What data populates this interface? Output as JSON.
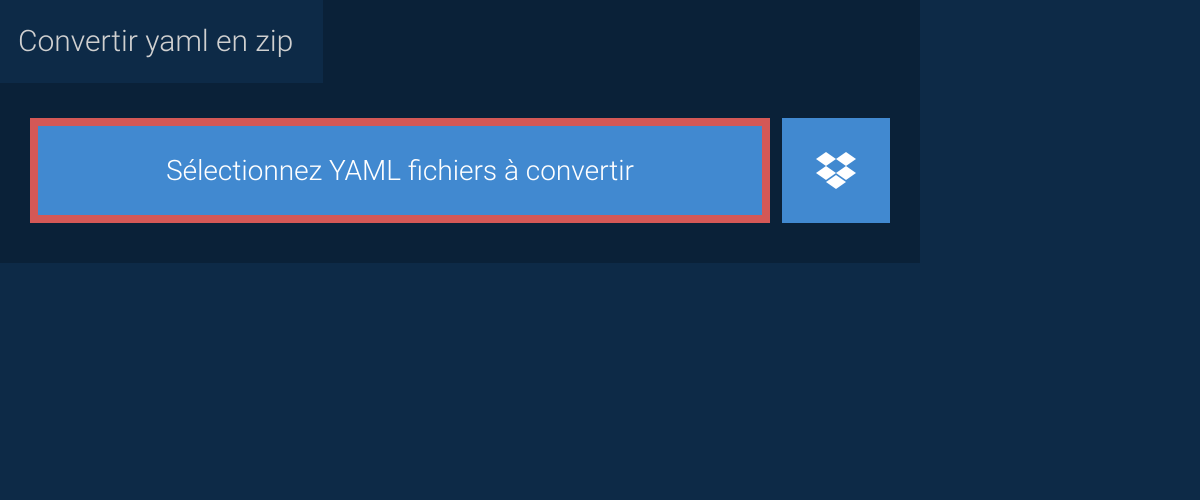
{
  "tab": {
    "title": "Convertir yaml en zip"
  },
  "buttons": {
    "select_files_label": "Sélectionnez YAML fichiers à convertir"
  },
  "colors": {
    "background": "#0d2a47",
    "panel": "#0a2138",
    "button_bg": "#4189d0",
    "button_border": "#d45856"
  }
}
